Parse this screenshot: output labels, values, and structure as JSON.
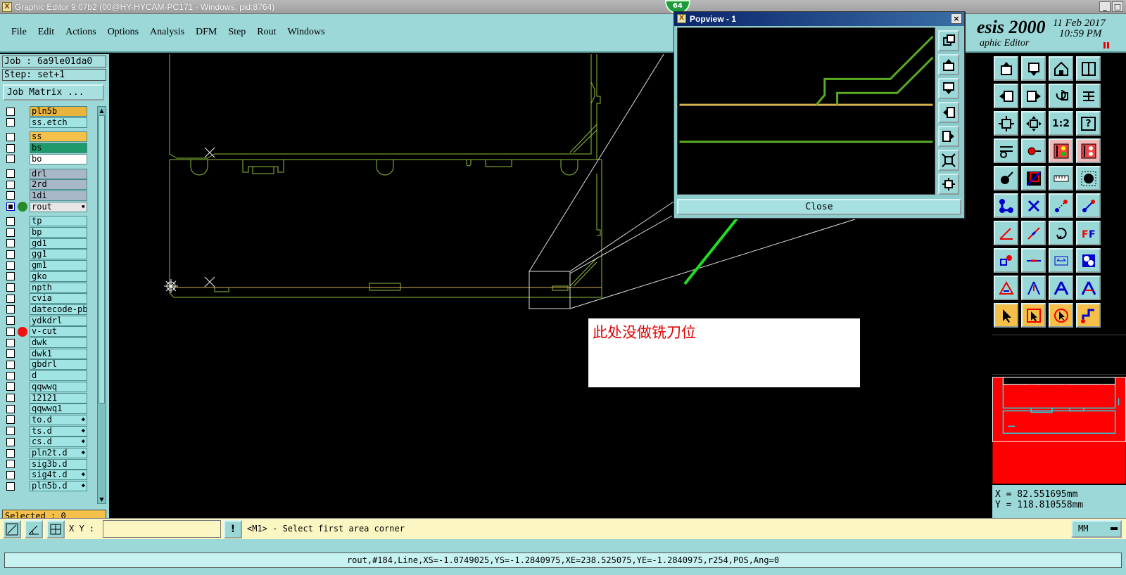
{
  "window": {
    "title": "Graphic Editor 9.07b2 (00@HY-HYCAM-PC171 - Windows, pid:8764)",
    "indicator": "64",
    "app_icon": "X"
  },
  "menu": {
    "items": [
      "File",
      "Edit",
      "Actions",
      "Options",
      "Analysis",
      "DFM",
      "Step",
      "Rout",
      "Windows"
    ]
  },
  "branding": {
    "title": "esis 2000",
    "subtitle": "aphic Editor",
    "date": "11 Feb 2017",
    "time": "10:59 PM"
  },
  "left_panel": {
    "job": "Job : 6a9le01da0",
    "step": "Step: set+1",
    "job_matrix_label": "Job Matrix ...",
    "selected": "Selected : 0"
  },
  "layers": [
    {
      "name": "pln5b",
      "color": "#e8b43c",
      "checked": false,
      "dot": ""
    },
    {
      "name": "ss.etch",
      "color": "#a0e4e4",
      "checked": false,
      "dot": ""
    },
    {
      "name": "ss",
      "color": "#f5c04a",
      "checked": false,
      "dot": ""
    },
    {
      "name": "bs",
      "color": "#1f9a6a",
      "checked": false,
      "dot": ""
    },
    {
      "name": "bo",
      "color": "#ffffff",
      "checked": false,
      "dot": ""
    },
    {
      "name": "drl",
      "color": "#a8b8c8",
      "checked": false,
      "dot": ""
    },
    {
      "name": "2rd",
      "color": "#a8b8c8",
      "checked": false,
      "dot": ""
    },
    {
      "name": "1di",
      "color": "#a8b8c8",
      "checked": false,
      "dot": ""
    },
    {
      "name": "rout",
      "color": "#e6e6e6",
      "checked": true,
      "dot": "#2a8a2a",
      "marker": "▪"
    },
    {
      "name": "tp",
      "color": "#a0e4e4",
      "checked": false,
      "dot": ""
    },
    {
      "name": "bp",
      "color": "#a0e4e4",
      "checked": false,
      "dot": ""
    },
    {
      "name": "gd1",
      "color": "#a0e4e4",
      "checked": false,
      "dot": ""
    },
    {
      "name": "gg1",
      "color": "#a0e4e4",
      "checked": false,
      "dot": ""
    },
    {
      "name": "gm1",
      "color": "#a0e4e4",
      "checked": false,
      "dot": ""
    },
    {
      "name": "gko",
      "color": "#a0e4e4",
      "checked": false,
      "dot": ""
    },
    {
      "name": "npth",
      "color": "#a0e4e4",
      "checked": false,
      "dot": ""
    },
    {
      "name": "cvia",
      "color": "#a0e4e4",
      "checked": false,
      "dot": ""
    },
    {
      "name": "datecode-pbe",
      "color": "#a0e4e4",
      "checked": false,
      "dot": ""
    },
    {
      "name": "ydkdrl",
      "color": "#a0e4e4",
      "checked": false,
      "dot": ""
    },
    {
      "name": "v-cut",
      "color": "#a0e4e4",
      "checked": false,
      "dot": "#ee1111"
    },
    {
      "name": "dwk",
      "color": "#a0e4e4",
      "checked": false,
      "dot": ""
    },
    {
      "name": "dwk1",
      "color": "#a0e4e4",
      "checked": false,
      "dot": ""
    },
    {
      "name": "gbdrl",
      "color": "#a0e4e4",
      "checked": false,
      "dot": ""
    },
    {
      "name": "d",
      "color": "#a0e4e4",
      "checked": false,
      "dot": ""
    },
    {
      "name": "qqwwq",
      "color": "#a0e4e4",
      "checked": false,
      "dot": ""
    },
    {
      "name": "12121",
      "color": "#a0e4e4",
      "checked": false,
      "dot": ""
    },
    {
      "name": "qqwwq1",
      "color": "#a0e4e4",
      "checked": false,
      "dot": ""
    },
    {
      "name": "to.d",
      "color": "#a0e4e4",
      "checked": false,
      "dot": "",
      "marker": "◆"
    },
    {
      "name": "ts.d",
      "color": "#a0e4e4",
      "checked": false,
      "dot": "",
      "marker": "◆"
    },
    {
      "name": "cs.d",
      "color": "#a0e4e4",
      "checked": false,
      "dot": "",
      "marker": "◆"
    },
    {
      "name": "pln2t.d",
      "color": "#a0e4e4",
      "checked": false,
      "dot": "",
      "marker": "◆"
    },
    {
      "name": "sig3b.d",
      "color": "#a0e4e4",
      "checked": false,
      "dot": ""
    },
    {
      "name": "sig4t.d",
      "color": "#a0e4e4",
      "checked": false,
      "dot": "",
      "marker": "◆"
    },
    {
      "name": "pln5b.d",
      "color": "#a0e4e4",
      "checked": false,
      "dot": "",
      "marker": "◆"
    }
  ],
  "popview": {
    "title": "Popview - 1",
    "close_label": "Close",
    "close_x": "×"
  },
  "annotation": {
    "text": "此处没做铣刀位",
    "color": "#e00000"
  },
  "right_toolbar": {
    "tools": [
      "move-up-icon",
      "move-down-icon",
      "home-icon",
      "window-split-icon",
      "move-left-icon",
      "move-right-icon",
      "rotate-icon",
      "mirror-icon",
      "zoom-fit-icon",
      "zoom-home-icon",
      "scale-1-2-icon",
      "help-icon",
      "snap-icon",
      "pad-icon",
      "traffic-light-red-icon",
      "traffic-light-icon",
      "dot-select-icon",
      "net-highlight-icon",
      "ruler-icon",
      "pad-dot-icon",
      "connect-icon",
      "delete-node-icon",
      "node-arrow-icon",
      "node-arrow2-icon",
      "line-angle-icon",
      "line-slope-icon",
      "undo-arc-icon",
      "ff-icon",
      "pad-pair-icon",
      "line-break-icon",
      "dimension-icon",
      "multi-pad-icon",
      "triangle-icon",
      "triangle-up-icon",
      "letter-a-icon",
      "letter-a2-icon",
      "pointer-icon",
      "pointer-box-icon",
      "pointer-circle-icon",
      "route-icon"
    ],
    "labels": {
      "scale": "1:2",
      "help": "?",
      "ff": "FF"
    }
  },
  "coordinates": {
    "x": "X =  82.551695mm",
    "y": "Y = 118.810558mm"
  },
  "prompt_bar": {
    "xy_label": "X Y :",
    "xy_value": "",
    "alert": "!",
    "prompt": "<M1> - Select first area corner",
    "units": "MM"
  },
  "status": {
    "line": "rout,#184,Line,XS=-1.0749025,YS=-1.2840975,XE=238.525075,YE=-1.2840975,r254,POS,Ang=0"
  },
  "colors": {
    "panel": "#9cd8d8",
    "board_outline": "#8fbf3a",
    "rout_line": "#d4b050",
    "arrow": "#22dd22",
    "minimap_fill": "#ff0000",
    "minimap_outline": "#19d8e8"
  }
}
